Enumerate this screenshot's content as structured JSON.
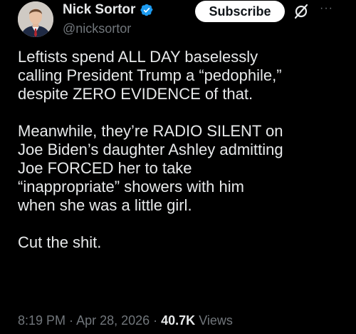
{
  "author": {
    "display_name": "Nick Sortor",
    "handle": "@nicksortor",
    "verified": true
  },
  "actions": {
    "subscribe_label": "Subscribe",
    "grok_icon": "grok-icon",
    "more_label": "···"
  },
  "tweet": {
    "paragraphs": [
      {
        "lines": [
          "Leftists spend ALL DAY baselessly",
          "calling President Trump a “pedophile,”",
          "despite ZERO EVIDENCE of that."
        ]
      },
      {
        "lines": [
          "Meanwhile, they’re RADIO SILENT on",
          "Joe Biden’s daughter Ashley admitting",
          "Joe FORCED her to take",
          "“inappropriate” showers with him",
          "when she was a little girl."
        ]
      },
      {
        "lines": [
          "Cut the shit."
        ]
      }
    ]
  },
  "meta": {
    "time": "8:19 PM",
    "separator": " · ",
    "date": "Apr 28, 2026",
    "views_count": "40.7K",
    "views_label": " Views"
  },
  "colors": {
    "background": "#000000",
    "primary_text": "#e7e9ea",
    "secondary_text": "#71767b",
    "verified_badge": "#1d9bf0"
  }
}
